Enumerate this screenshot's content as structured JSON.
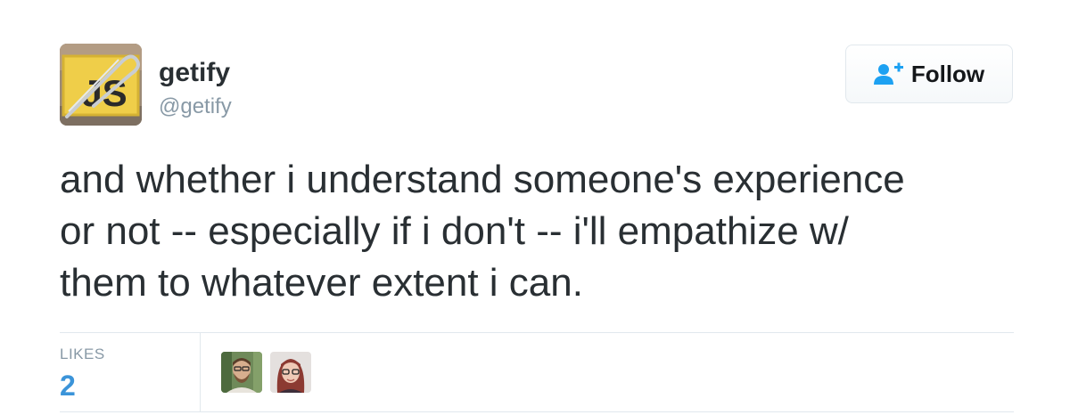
{
  "author": {
    "display_name": "getify",
    "screen_name": "@getify",
    "avatar_icon": "js-safety-pin-avatar-icon",
    "avatar_text": "JS"
  },
  "follow_button": {
    "label": "Follow",
    "icon": "add-user-icon",
    "icon_color": "#1da1f2"
  },
  "tweet": {
    "lines": [
      "and whether i understand someone's experience",
      "or not -- especially if i don't -- i'll empathize w/",
      "them to whatever extent i can."
    ]
  },
  "stats": {
    "likes_label": "LIKES",
    "likes_count": "2",
    "likes_count_color": "#3b94d9",
    "likers": [
      {
        "icon": "bearded-man-avatar-icon"
      },
      {
        "icon": "woman-with-glasses-avatar-icon"
      }
    ]
  }
}
